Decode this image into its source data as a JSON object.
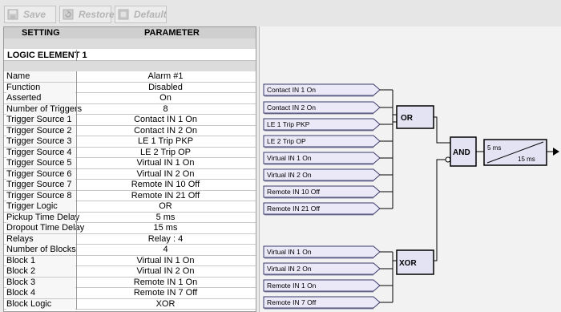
{
  "toolbar": {
    "save_label": "Save",
    "restore_label": "Restore",
    "default_label": "Default"
  },
  "table": {
    "header_setting": "SETTING",
    "header_parameter": "PARAMETER",
    "section_title": "LOGIC ELEMENT 1",
    "rows": [
      {
        "setting": "Name",
        "parameter": "Alarm #1"
      },
      {
        "setting": "Function",
        "parameter": "Disabled"
      },
      {
        "setting": "Asserted",
        "parameter": "On"
      },
      {
        "setting": "Number of Triggers",
        "parameter": "8"
      },
      {
        "setting": "Trigger Source 1",
        "parameter": "Contact IN 1 On"
      },
      {
        "setting": "Trigger Source 2",
        "parameter": "Contact IN 2 On"
      },
      {
        "setting": "Trigger Source 3",
        "parameter": "LE 1 Trip PKP"
      },
      {
        "setting": "Trigger Source 4",
        "parameter": "LE 2 Trip OP"
      },
      {
        "setting": "Trigger Source 5",
        "parameter": "Virtual IN 1 On"
      },
      {
        "setting": "Trigger Source 6",
        "parameter": "Virtual IN 2 On"
      },
      {
        "setting": "Trigger Source 7",
        "parameter": "Remote IN 10 Off"
      },
      {
        "setting": "Trigger Source 8",
        "parameter": "Remote IN 21 Off"
      },
      {
        "setting": "Trigger Logic",
        "parameter": "OR"
      },
      {
        "setting": "Pickup Time Delay",
        "parameter": "5 ms"
      },
      {
        "setting": "Dropout Time Delay",
        "parameter": "15 ms"
      },
      {
        "setting": "Relays",
        "parameter": "Relay : 4"
      },
      {
        "setting": "Number of Blocks",
        "parameter": "4"
      },
      {
        "setting": "Block 1",
        "parameter": "Virtual IN 1 On"
      },
      {
        "setting": "Block 2",
        "parameter": "Virtual IN 2 On"
      },
      {
        "setting": "Block 3",
        "parameter": "Remote IN 1 On"
      },
      {
        "setting": "Block 4",
        "parameter": "Remote IN 7 Off"
      },
      {
        "setting": "Block Logic",
        "parameter": "XOR"
      }
    ]
  },
  "diagram": {
    "trigger_inputs": [
      "Contact IN 1 On",
      "Contact IN 2 On",
      "LE 1 Trip PKP",
      "LE 2 Trip OP",
      "Virtual IN 1 On",
      "Virtual IN 2 On",
      "Remote IN 10 Off",
      "Remote IN 21 Off"
    ],
    "block_inputs": [
      "Virtual IN 1 On",
      "Virtual IN 2 On",
      "Remote IN 1 On",
      "Remote IN 7 Off"
    ],
    "trigger_gate": "OR",
    "block_gate": "XOR",
    "and_gate": "AND",
    "pickup_label": "5 ms",
    "dropout_label": "15 ms"
  },
  "colors": {
    "input_fill": "#ebe9f8",
    "input_border": "#3a3a6a",
    "gate_fill": "#e4e3f4",
    "wire": "#000000"
  }
}
